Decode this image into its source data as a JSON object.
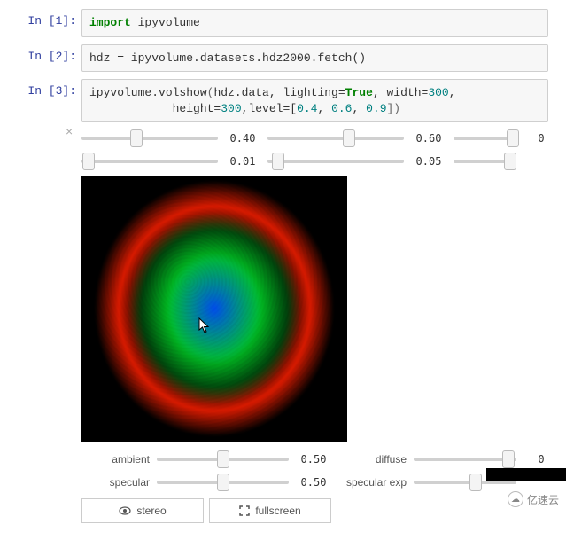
{
  "cells": {
    "c1": {
      "prompt": "In [1]:",
      "kw": "import",
      "rest": " ipyvolume"
    },
    "c2": {
      "prompt": "In [2]:",
      "line": "hdz = ipyvolume.datasets.hdz2000.fetch()"
    },
    "c3": {
      "prompt": "In [3]:",
      "fn": "ipyvolume.volshow",
      "arg_data": "hdz.data, lighting=",
      "true": "True",
      "tail1": ", width=",
      "w": "300",
      "tail2": ",\n            height=",
      "h": "300",
      "tail3": ",level=[",
      "lv1": "0.4",
      "c": ", ",
      "lv2": "0.6",
      "lv3": "0.9",
      "close": "])"
    }
  },
  "close_x": "×",
  "top_row1": {
    "v1": "0.40",
    "v2": "0.60",
    "v3": "0"
  },
  "top_row2": {
    "v1": "0.01",
    "v2": "0.05",
    "v3": ""
  },
  "ctrl": {
    "ambient": {
      "label": "ambient",
      "value": "0.50"
    },
    "diffuse": {
      "label": "diffuse",
      "value": "0"
    },
    "specular": {
      "label": "specular",
      "value": "0.50"
    },
    "specular_exp": {
      "label": "specular exp",
      "value": ""
    }
  },
  "buttons": {
    "stereo": "stereo",
    "fullscreen": "fullscreen"
  },
  "watermark": "亿速云",
  "thumb_pos": {
    "r1a": "40%",
    "r1b": "60%",
    "r1c": "95%",
    "r2a": "5%",
    "r2b": "8%",
    "r2c": "90%",
    "amb": "50%",
    "diff": "92%",
    "spec": "50%",
    "spexp": "60%"
  }
}
